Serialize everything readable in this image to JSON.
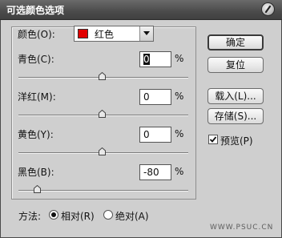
{
  "window": {
    "title": "可选颜色选项"
  },
  "colors": {
    "label": "颜色(O):",
    "selected": "红色",
    "swatch": "#e10000"
  },
  "sliders": [
    {
      "label": "青色(C):",
      "value": "0",
      "unit": "%",
      "level_percent": 0
    },
    {
      "label": "洋红(M):",
      "value": "0",
      "unit": "%",
      "level_percent": 0
    },
    {
      "label": "黄色(Y):",
      "value": "0",
      "unit": "%",
      "level_percent": 0
    },
    {
      "label": "黑色(B):",
      "value": "-80",
      "unit": "%",
      "level_percent": -80
    }
  ],
  "buttons": {
    "ok": "确定",
    "reset": "复位",
    "load": "载入(L)...",
    "save": "存储(S)..."
  },
  "preview": {
    "label": "预览(P)",
    "checked": true
  },
  "method": {
    "label": "方法:",
    "options": [
      {
        "label": "相对(R)",
        "selected": true
      },
      {
        "label": "绝对(A)",
        "selected": false
      }
    ]
  },
  "watermark": "WWW.PSUC.CN"
}
